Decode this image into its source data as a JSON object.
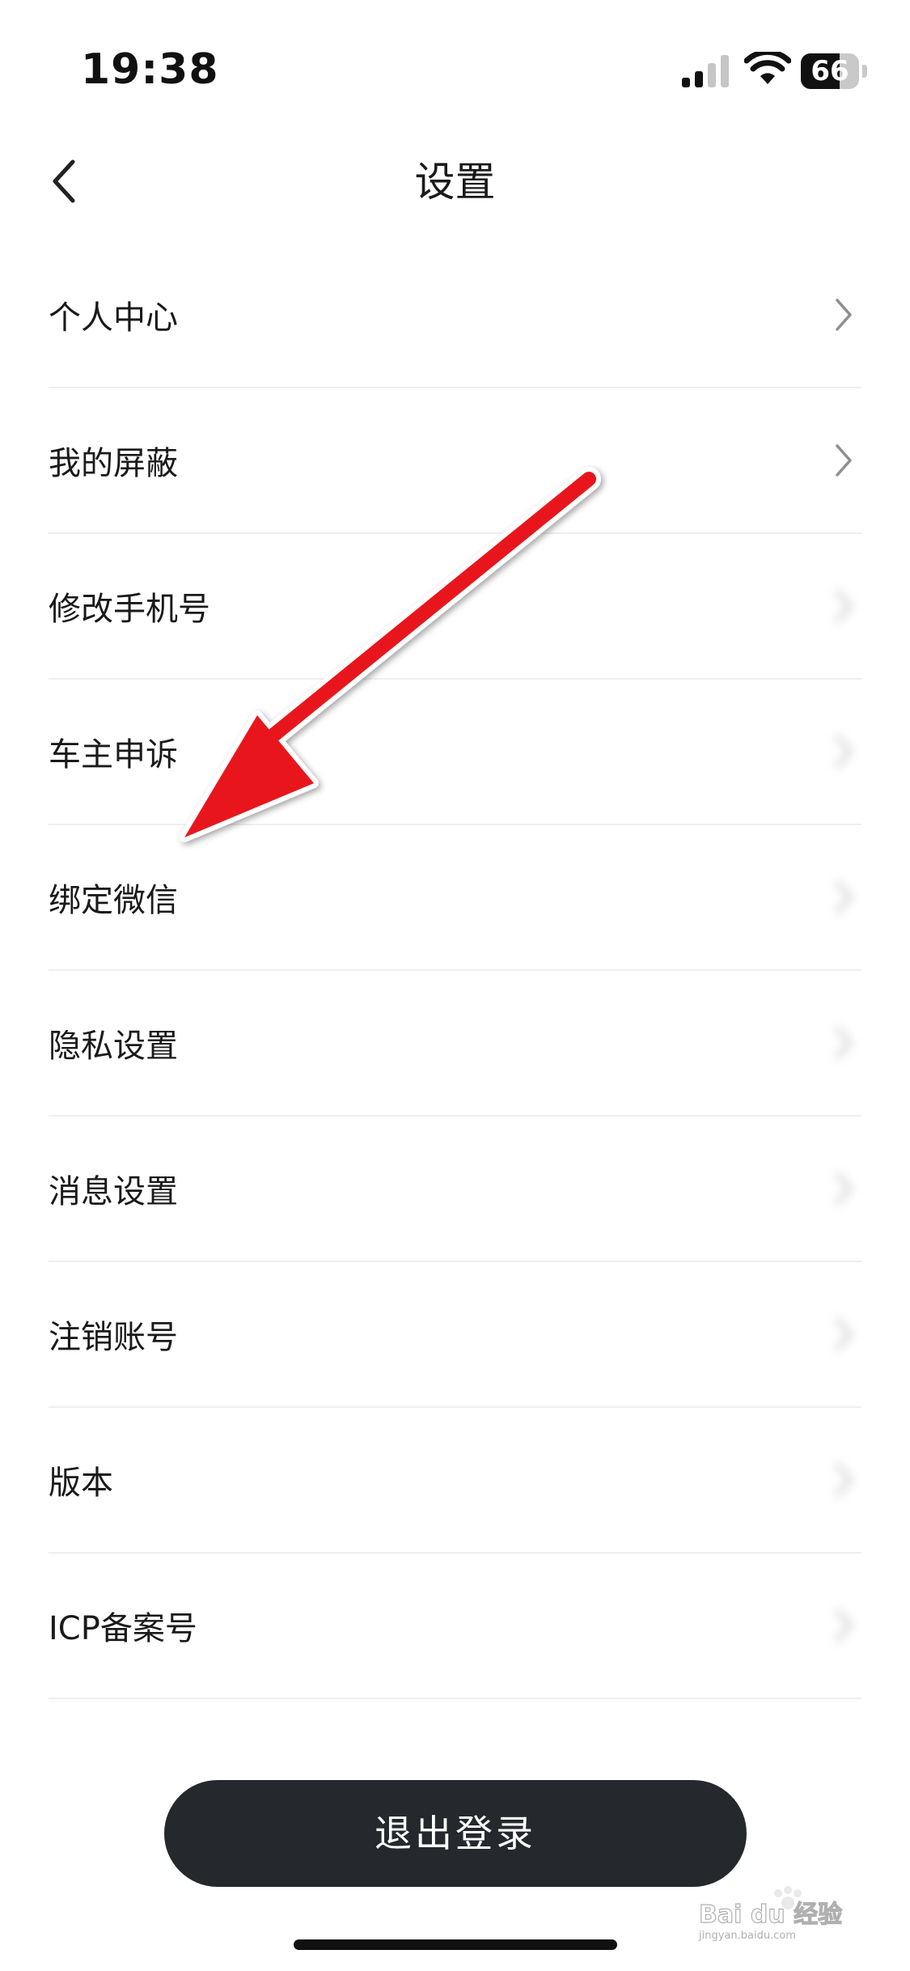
{
  "status_bar": {
    "time": "19:38",
    "battery_level": "66",
    "battery_fraction": 0.66,
    "icons": [
      "signal-icon",
      "wifi-icon",
      "battery-icon"
    ]
  },
  "nav": {
    "title": "设置",
    "back_icon": "chevron-left-icon"
  },
  "settings": {
    "items": [
      {
        "label": "个人中心",
        "value": "",
        "value_blurred": false
      },
      {
        "label": "我的屏蔽",
        "value": "",
        "value_blurred": false
      },
      {
        "label": "修改手机号",
        "value": "",
        "value_blurred": true
      },
      {
        "label": "车主申诉",
        "value": "",
        "value_blurred": true
      },
      {
        "label": "绑定微信",
        "value": "",
        "value_blurred": true
      },
      {
        "label": "隐私设置",
        "value": "",
        "value_blurred": true
      },
      {
        "label": "消息设置",
        "value": "",
        "value_blurred": true
      },
      {
        "label": "注销账号",
        "value": "",
        "value_blurred": true
      },
      {
        "label": "版本",
        "value": "",
        "value_blurred": true
      },
      {
        "label": "ICP备案号",
        "value": "",
        "value_blurred": true
      }
    ]
  },
  "logout": {
    "label": "退出登录"
  },
  "colors": {
    "accent_dark": "#25282c",
    "annotation_red": "#e8161b",
    "divider": "#efefef",
    "chevron": "#8e8e93"
  },
  "watermark": {
    "brand": "Bai du 经验",
    "url": "jingyan.baidu.com"
  }
}
